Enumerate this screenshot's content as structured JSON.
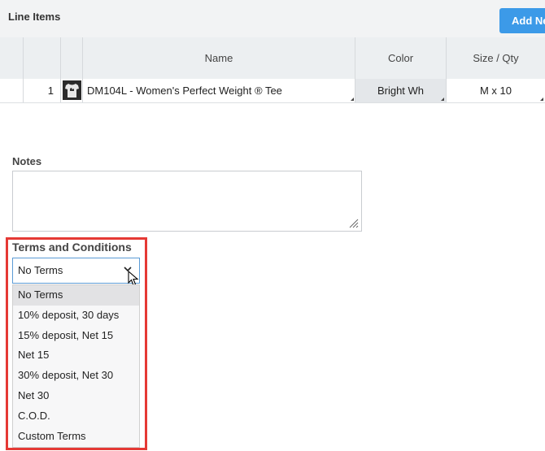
{
  "line_items": {
    "title": "Line Items",
    "add_button_label": "Add Ne",
    "columns": [
      "",
      "",
      "",
      "Name",
      "Color",
      "Size / Qty"
    ],
    "rows": [
      {
        "index": "1",
        "thumbnail_icon": "tshirt-icon",
        "name": "DM104L - Women's Perfect Weight ® Tee",
        "color": "Bright Wh",
        "size_qty": "M x 10"
      }
    ]
  },
  "notes": {
    "label": "Notes",
    "value": ""
  },
  "terms": {
    "label": "Terms and Conditions",
    "selected": "No Terms",
    "options": [
      "No Terms",
      "10% deposit, 30 days",
      "15% deposit, Net 15",
      "Net 15",
      "30% deposit, Net 30",
      "Net 30",
      "C.O.D.",
      "Custom Terms"
    ],
    "highlight_color": "#e53935"
  },
  "colors": {
    "accent": "#3c9ae8",
    "highlight": "#e53935"
  }
}
